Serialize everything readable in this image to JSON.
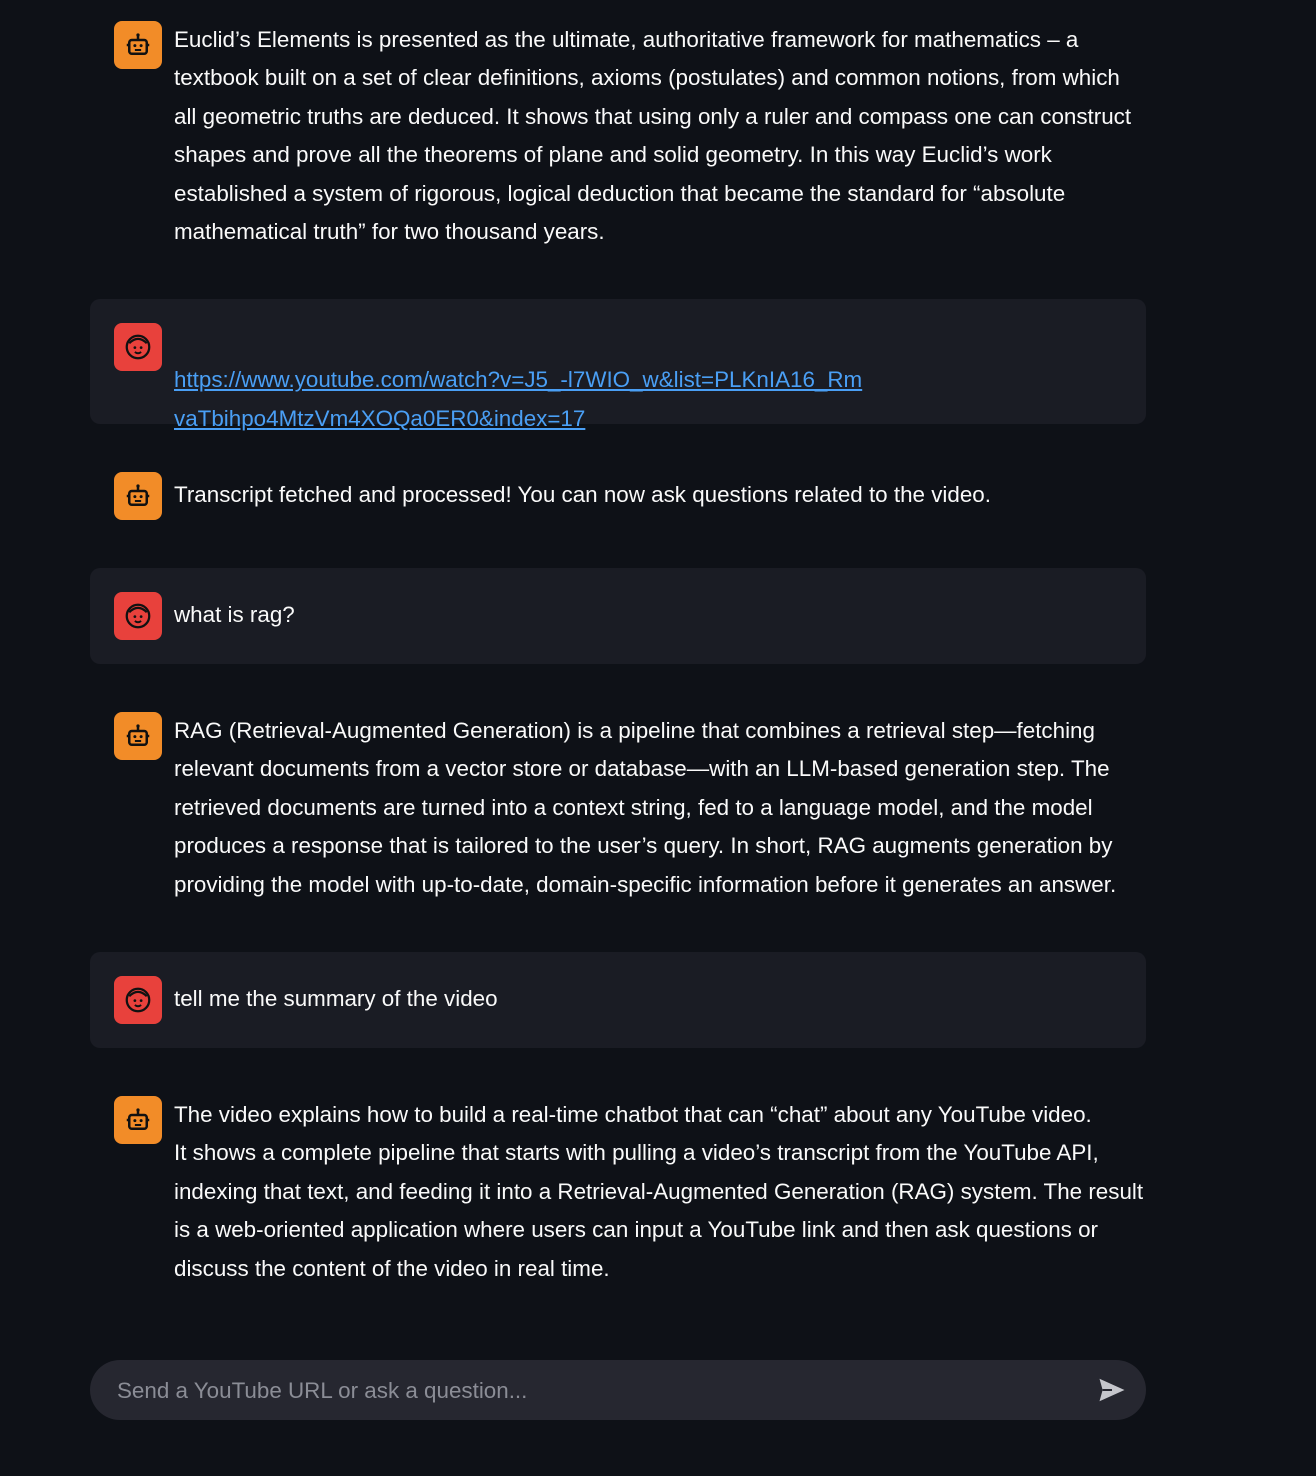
{
  "messages": [
    {
      "role": "assistant",
      "avatar": "robot-icon",
      "text": "Euclid’s Elements is presented as the ultimate, authoritative framework for mathematics – a textbook built on a set of clear definitions, axioms (postulates) and common notions, from which all geometric truths are deduced. It shows that using only a ruler and compass one can construct shapes and prove all the theorems of plane and solid geometry. In this way Euclid’s work established a system of rigorous, logical deduction that became the standard for “absolute mathematical truth” for two thousand years."
    },
    {
      "role": "user",
      "avatar": "smiley-face-icon",
      "link": "https://www.youtube.com/watch?v=J5_-l7WIO_w&list=PLKnIA16_RmvaTbihpo4MtzVm4XOQa0ER0&index=17"
    },
    {
      "role": "assistant",
      "avatar": "robot-icon",
      "text": "Transcript fetched and processed! You can now ask questions related to the video."
    },
    {
      "role": "user",
      "avatar": "smiley-face-icon",
      "text": "what is rag?"
    },
    {
      "role": "assistant",
      "avatar": "robot-icon",
      "text": "RAG (Retrieval-Augmented Generation) is a pipeline that combines a retrieval step—fetching relevant documents from a vector store or database—with an LLM-based generation step. The retrieved documents are turned into a context string, fed to a language model, and the model produces a response that is tailored to the user’s query. In short, RAG augments generation by providing the model with up-to-date, domain-specific information before it generates an answer."
    },
    {
      "role": "user",
      "avatar": "smiley-face-icon",
      "text": "tell me the summary of the video"
    },
    {
      "role": "assistant",
      "avatar": "robot-icon",
      "text": "The video explains how to build a real-time chatbot that can “chat” about any YouTube video.\nIt shows a complete pipeline that starts with pulling a video’s transcript from the YouTube API, indexing that text, and feeding it into a Retrieval-Augmented Generation (RAG) system. The result is a web-oriented application where users can input a YouTube link and then ask questions or discuss the content of the video in real time."
    }
  ],
  "chat_input": {
    "placeholder": "Send a YouTube URL or ask a question...",
    "value": "",
    "send_icon": "send-arrow-icon"
  },
  "colors": {
    "background": "#0e1117",
    "user_bubble": "#1a1c24",
    "bot_avatar": "#f28c28",
    "user_avatar": "#e8413c",
    "link": "#4a9ff5",
    "input_bg": "#262730"
  }
}
